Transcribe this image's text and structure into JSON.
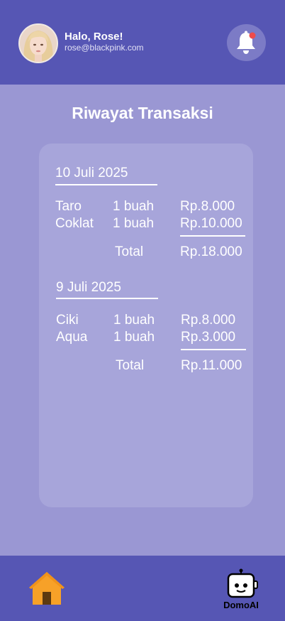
{
  "header": {
    "greeting": "Halo, Rose!",
    "email": "rose@blackpink.com"
  },
  "page": {
    "title": "Riwayat Transaksi"
  },
  "transactions": [
    {
      "date": "10 Juli 2025",
      "items": [
        {
          "name": "Taro",
          "qty": "1 buah",
          "price": "Rp.8.000"
        },
        {
          "name": "Coklat",
          "qty": "1 buah",
          "price": "Rp.10.000"
        }
      ],
      "total_label": "Total",
      "total": "Rp.18.000"
    },
    {
      "date": "9 Juli 2025",
      "items": [
        {
          "name": "Ciki",
          "qty": "1 buah",
          "price": "Rp.8.000"
        },
        {
          "name": "Aqua",
          "qty": "1 buah",
          "price": "Rp.3.000"
        }
      ],
      "total_label": "Total",
      "total": "Rp.11.000"
    }
  ],
  "bottom_nav": {
    "home_icon": "home-icon",
    "robot_icon": "robot-icon",
    "robot_label": "DomoAI"
  },
  "colors": {
    "header": "#5656b4",
    "background": "#9a97d3",
    "card": "#a7a5da",
    "home": "#f7a128",
    "notification_dot": "#ef4b4b"
  }
}
